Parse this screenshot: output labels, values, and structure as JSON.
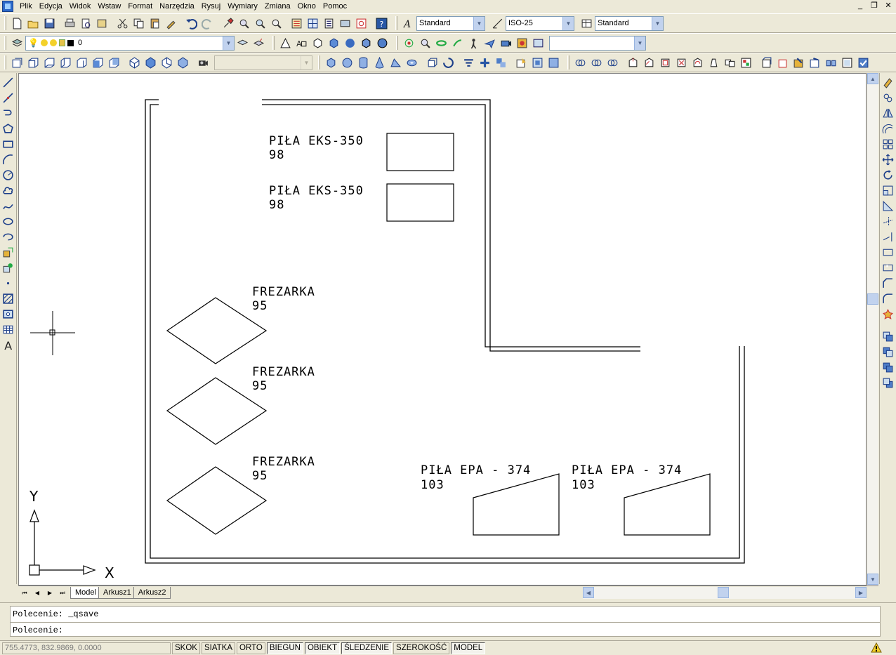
{
  "menu": {
    "items": [
      "Plik",
      "Edycja",
      "Widok",
      "Wstaw",
      "Format",
      "Narzędzia",
      "Rysuj",
      "Wymiary",
      "Zmiana",
      "Okno",
      "Pomoc"
    ]
  },
  "window_controls": {
    "minimize": "_",
    "restore": "❐",
    "close": "✕"
  },
  "toolbars": {
    "text_style": "Standard",
    "dim_style": "ISO-25",
    "table_style": "Standard",
    "layer_name": "0",
    "view_combo": "",
    "ucs_combo": ""
  },
  "drawing": {
    "labels": {
      "saw1_name": "PIŁA EKS-350",
      "saw1_num": "98",
      "saw2_name": "PIŁA EKS-350",
      "saw2_num": "98",
      "mill1_name": "FREZARKA",
      "mill1_num": "95",
      "mill2_name": "FREZARKA",
      "mill2_num": "95",
      "mill3_name": "FREZARKA",
      "mill3_num": "95",
      "epa1_name": "PIŁA EPA - 374",
      "epa1_num": "103",
      "epa2_name": "PIŁA EPA - 374",
      "epa2_num": "103"
    },
    "ucs": {
      "y_label": "Y",
      "x_label": "X"
    }
  },
  "layout_tabs": {
    "nav": [
      "⏮",
      "◀",
      "▶",
      "⏭"
    ],
    "tabs": [
      "Model",
      "Arkusz1",
      "Arkusz2"
    ],
    "active": "Model"
  },
  "command": {
    "history": "Polecenie: _qsave",
    "prompt": "Polecenie:"
  },
  "status": {
    "coordinates": "755.4773, 832.9869, 0.0000",
    "toggles": [
      {
        "label": "SKOK",
        "on": false
      },
      {
        "label": "SIATKA",
        "on": false
      },
      {
        "label": "ORTO",
        "on": false
      },
      {
        "label": "BIEGUN",
        "on": true
      },
      {
        "label": "OBIEKT",
        "on": true
      },
      {
        "label": "ŚLEDZENIE",
        "on": true
      },
      {
        "label": "SZEROKOŚĆ",
        "on": false
      },
      {
        "label": "MODEL",
        "on": true
      }
    ]
  },
  "colors": {
    "chrome": "#ece9d8",
    "canvas": "#ffffff",
    "accent": "#2d6ac9"
  }
}
